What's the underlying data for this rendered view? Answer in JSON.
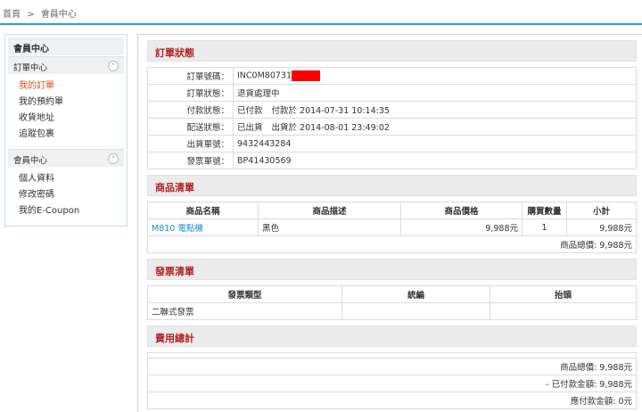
{
  "breadcrumb": {
    "home": "首頁",
    "separator": ">",
    "current": "會員中心"
  },
  "sidebar": {
    "title": "會員中心",
    "groups": [
      {
        "label": "訂單中心",
        "toggle": "⌃",
        "items": [
          {
            "label": "我的訂單",
            "active": true
          },
          {
            "label": "我的預約單"
          },
          {
            "label": "收貨地址"
          },
          {
            "label": "追蹤包裹"
          }
        ]
      },
      {
        "label": "會員中心",
        "toggle": "⌃",
        "items": [
          {
            "label": "個人資料"
          },
          {
            "label": "修改密碼"
          },
          {
            "label": "我的E-Coupon"
          }
        ]
      }
    ]
  },
  "order_status": {
    "title": "訂單狀態",
    "rows": [
      {
        "label": "訂單號碼：",
        "value": "INC0M80731"
      },
      {
        "label": "訂單狀態：",
        "value": "退貨處理中"
      },
      {
        "label": "付款狀態：",
        "value": "已付款",
        "extra": "付款於 2014-07-31 10:14:35"
      },
      {
        "label": "配送狀態：",
        "value": "已出貨",
        "extra": "出貨於 2014-08-01 23:49:02"
      },
      {
        "label": "出貨單號：",
        "value": "9432443284"
      },
      {
        "label": "發票單號：",
        "value": "BP41430569"
      }
    ]
  },
  "products": {
    "title": "商品清單",
    "headers": [
      "商品名稱",
      "商品描述",
      "商品價格",
      "購買數量",
      "小計"
    ],
    "rows": [
      {
        "name": "M810 電點機",
        "desc": "黑色",
        "price": "9,988元",
        "qty": "1",
        "subtotal": "9,988元"
      }
    ],
    "total": "商品總價: 9,988元"
  },
  "invoice": {
    "title": "發票清單",
    "headers": [
      "發票類型",
      "統編",
      "抬頭"
    ],
    "rows": [
      {
        "type": "二聯式發票",
        "tax_id": "",
        "header": ""
      }
    ]
  },
  "fees": {
    "title": "費用總計",
    "lines": [
      "商品總價: 9,988元",
      "- 已付款金額: 9,988元",
      "應付款金額: 0元"
    ]
  }
}
